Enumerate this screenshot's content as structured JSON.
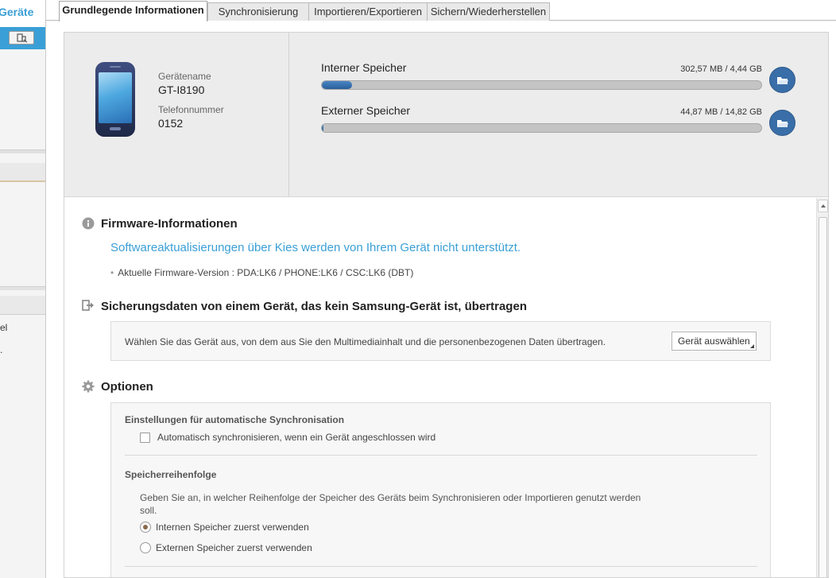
{
  "sidebar": {
    "title": "Geräte",
    "item_partial": "el",
    "item_partial2": "."
  },
  "tabs": [
    {
      "label": "Grundlegende Informationen",
      "active": true
    },
    {
      "label": "Synchronisierung",
      "active": false
    },
    {
      "label": "Importieren/Exportieren",
      "active": false
    },
    {
      "label": "Sichern/Wiederherstellen",
      "active": false
    }
  ],
  "device": {
    "name_label": "Gerätename",
    "name_value": "GT-I8190",
    "phone_label": "Telefonnummer",
    "phone_value": "0152"
  },
  "storage": {
    "internal": {
      "label": "Interner Speicher",
      "value": "302,57 MB / 4,44 GB",
      "used_fraction": 0.068
    },
    "external": {
      "label": "Externer Speicher",
      "value": "44,87 MB / 14,82 GB",
      "used_fraction": 0.003
    }
  },
  "firmware": {
    "title": "Firmware-Informationen",
    "message": "Softwareaktualisierungen über Kies werden von Ihrem Gerät nicht unterstützt.",
    "version": "Aktuelle Firmware-Version : PDA:LK6 / PHONE:LK6 / CSC:LK6 (DBT)"
  },
  "transfer": {
    "title": "Sicherungsdaten von einem Gerät, das kein Samsung-Gerät ist, übertragen",
    "description": "Wählen Sie das Gerät aus, von dem aus Sie den Multimediainhalt und die personenbezogenen Daten übertragen.",
    "button": "Gerät auswählen"
  },
  "options": {
    "title": "Optionen",
    "autosync_heading": "Einstellungen für automatische Synchronisation",
    "autosync_checkbox": "Automatisch synchronisieren, wenn ein Gerät angeschlossen wird",
    "autosync_checked": false,
    "order_heading": "Speicherreihenfolge",
    "order_description": "Geben Sie an, in welcher Reihenfolge der Speicher des Geräts beim Synchronisieren oder Importieren genutzt werden soll.",
    "order_internal": "Internen Speicher zuerst verwenden",
    "order_external": "Externen Speicher zuerst verwenden",
    "order_selected": "internal"
  },
  "colors": {
    "accent": "#3a9fd6",
    "bar_fill": "#2a5f9a",
    "folder_button": "#3a6ea8"
  }
}
